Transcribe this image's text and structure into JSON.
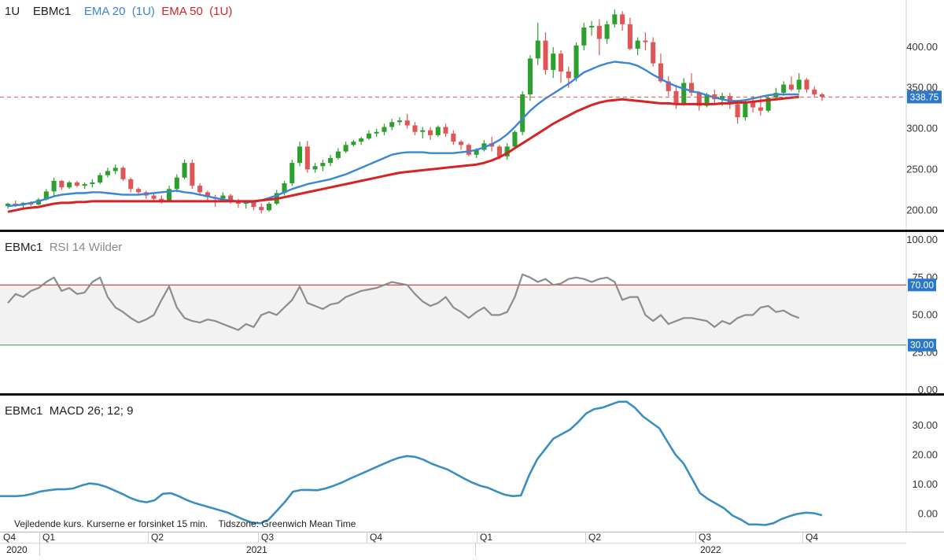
{
  "header": {
    "interval": "1U",
    "symbol": "EBMc1",
    "ema20_label": "EMA 20",
    "ema20_period": "(1U)",
    "ema50_label": "EMA 50",
    "ema50_period": "(1U)"
  },
  "rsi_panel": {
    "symbol": "EBMc1",
    "title": "RSI 14 Wilder"
  },
  "macd_panel": {
    "symbol": "EBMc1",
    "title": "MACD 26; 12; 9"
  },
  "footer_note": "Vejledende kurs. Kurserne er forsinket 15 min.",
  "timezone_note": "Tidszone: Greenwich Mean Time",
  "colors": {
    "up": "#2ca02c",
    "down": "#e05555",
    "ema20": "#3a86d4",
    "ema50": "#d62424",
    "rsi": "#8c8c8c",
    "macd": "#3a8fc1",
    "upper_band": "#cc3333",
    "lower_band": "#44aa44"
  },
  "chart_data": [
    {
      "type": "candlestick",
      "title": "EBMc1",
      "interval": "1U",
      "ylim": [
        180,
        450
      ],
      "y_ticks": [
        200,
        250,
        300,
        350,
        400
      ],
      "y_tick_labels": [
        "200.00",
        "250.00",
        "300.00",
        "350.00",
        "400.00"
      ],
      "last_price": 338.75,
      "last_price_label": "338.75",
      "candles": [
        [
          205,
          209,
          202,
          208
        ],
        [
          208,
          212,
          204,
          206
        ],
        [
          206,
          210,
          203,
          209
        ],
        [
          209,
          211,
          205,
          207
        ],
        [
          207,
          215,
          206,
          213
        ],
        [
          213,
          226,
          212,
          223
        ],
        [
          223,
          240,
          218,
          236
        ],
        [
          236,
          237,
          225,
          228
        ],
        [
          228,
          236,
          226,
          234
        ],
        [
          234,
          236,
          228,
          230
        ],
        [
          230,
          234,
          226,
          232
        ],
        [
          232,
          238,
          228,
          234
        ],
        [
          234,
          246,
          232,
          243
        ],
        [
          243,
          252,
          240,
          248
        ],
        [
          248,
          256,
          244,
          252
        ],
        [
          252,
          254,
          236,
          238
        ],
        [
          238,
          240,
          222,
          226
        ],
        [
          226,
          228,
          218,
          222
        ],
        [
          222,
          224,
          214,
          218
        ],
        [
          218,
          220,
          210,
          214
        ],
        [
          214,
          218,
          208,
          212
        ],
        [
          212,
          230,
          210,
          226
        ],
        [
          226,
          244,
          222,
          240
        ],
        [
          240,
          262,
          238,
          258
        ],
        [
          258,
          262,
          226,
          230
        ],
        [
          230,
          233,
          218,
          222
        ],
        [
          222,
          224,
          212,
          216
        ],
        [
          216,
          219,
          204,
          214
        ],
        [
          214,
          222,
          210,
          218
        ],
        [
          218,
          220,
          208,
          212
        ],
        [
          212,
          214,
          203,
          208
        ],
        [
          208,
          212,
          202,
          210
        ],
        [
          210,
          212,
          200,
          204
        ],
        [
          204,
          208,
          196,
          200
        ],
        [
          200,
          210,
          198,
          208
        ],
        [
          208,
          225,
          206,
          221
        ],
        [
          221,
          236,
          218,
          233
        ],
        [
          233,
          262,
          230,
          258
        ],
        [
          258,
          284,
          254,
          278
        ],
        [
          278,
          285,
          246,
          250
        ],
        [
          250,
          258,
          246,
          254
        ],
        [
          254,
          262,
          248,
          258
        ],
        [
          258,
          268,
          254,
          264
        ],
        [
          264,
          276,
          262,
          272
        ],
        [
          272,
          284,
          270,
          280
        ],
        [
          280,
          286,
          278,
          284
        ],
        [
          284,
          290,
          280,
          288
        ],
        [
          288,
          298,
          286,
          294
        ],
        [
          294,
          300,
          290,
          296
        ],
        [
          296,
          306,
          292,
          302
        ],
        [
          302,
          312,
          298,
          308
        ],
        [
          308,
          314,
          304,
          310
        ],
        [
          310,
          318,
          300,
          304
        ],
        [
          304,
          308,
          292,
          296
        ],
        [
          296,
          302,
          288,
          298
        ],
        [
          298,
          302,
          286,
          292
        ],
        [
          292,
          304,
          290,
          302
        ],
        [
          302,
          306,
          290,
          294
        ],
        [
          294,
          298,
          280,
          284
        ],
        [
          284,
          286,
          274,
          280
        ],
        [
          280,
          282,
          266,
          268
        ],
        [
          268,
          276,
          264,
          274
        ],
        [
          274,
          286,
          272,
          282
        ],
        [
          282,
          290,
          272,
          278
        ],
        [
          278,
          280,
          262,
          266
        ],
        [
          266,
          282,
          262,
          278
        ],
        [
          278,
          298,
          275,
          296
        ],
        [
          296,
          346,
          292,
          342
        ],
        [
          342,
          390,
          334,
          386
        ],
        [
          386,
          430,
          378,
          408
        ],
        [
          408,
          418,
          366,
          372
        ],
        [
          372,
          400,
          362,
          392
        ],
        [
          392,
          396,
          356,
          370
        ],
        [
          370,
          376,
          350,
          362
        ],
        [
          362,
          406,
          358,
          402
        ],
        [
          402,
          430,
          396,
          424
        ],
        [
          424,
          432,
          414,
          426
        ],
        [
          426,
          434,
          390,
          410
        ],
        [
          410,
          432,
          404,
          428
        ],
        [
          428,
          446,
          424,
          440
        ],
        [
          440,
          444,
          420,
          428
        ],
        [
          428,
          436,
          396,
          398
        ],
        [
          398,
          412,
          390,
          408
        ],
        [
          408,
          418,
          396,
          406
        ],
        [
          406,
          412,
          376,
          380
        ],
        [
          380,
          392,
          356,
          358
        ],
        [
          358,
          364,
          340,
          346
        ],
        [
          346,
          354,
          324,
          330
        ],
        [
          330,
          362,
          328,
          356
        ],
        [
          356,
          368,
          340,
          344
        ],
        [
          344,
          346,
          322,
          328
        ],
        [
          328,
          344,
          326,
          342
        ],
        [
          342,
          348,
          330,
          336
        ],
        [
          336,
          344,
          328,
          340
        ],
        [
          340,
          344,
          324,
          330
        ],
        [
          330,
          332,
          306,
          314
        ],
        [
          314,
          336,
          310,
          332
        ],
        [
          332,
          340,
          320,
          326
        ],
        [
          326,
          338,
          316,
          322
        ],
        [
          322,
          342,
          320,
          338
        ],
        [
          338,
          350,
          334,
          344
        ],
        [
          344,
          358,
          340,
          354
        ],
        [
          354,
          364,
          346,
          348
        ],
        [
          348,
          368,
          344,
          360
        ],
        [
          360,
          362,
          344,
          348
        ],
        [
          348,
          352,
          338,
          342
        ],
        [
          342,
          344,
          334,
          339
        ]
      ],
      "series": [
        {
          "name": "EMA 20",
          "values": [
            205,
            206,
            207,
            209,
            211,
            214,
            217,
            219,
            220,
            221,
            221,
            222,
            222,
            221,
            220,
            219,
            219,
            219,
            220,
            221,
            222,
            223,
            224,
            222,
            221,
            219,
            217,
            215,
            213,
            212,
            211,
            210,
            210,
            212,
            215,
            218,
            222,
            226,
            229,
            232,
            234,
            236,
            238,
            241,
            244,
            248,
            252,
            256,
            260,
            264,
            268,
            270,
            271,
            271,
            271,
            270,
            270,
            270,
            270,
            271,
            272,
            274,
            277,
            281,
            286,
            293,
            302,
            312,
            322,
            330,
            337,
            343,
            349,
            355,
            362,
            369,
            373,
            377,
            380,
            382,
            381,
            380,
            377,
            372,
            366,
            361,
            356,
            352,
            349,
            346,
            344,
            341,
            338,
            336,
            334,
            334,
            335,
            337,
            339,
            341,
            342,
            342,
            342,
            342
          ]
        },
        {
          "name": "EMA 50",
          "values": [
            198,
            200,
            202,
            203,
            204,
            206,
            208,
            209,
            209,
            210,
            210,
            211,
            211,
            211,
            211,
            211,
            211,
            211,
            211,
            211,
            211,
            211,
            211,
            211,
            211,
            211,
            211,
            211,
            211,
            211,
            211,
            211,
            211,
            212,
            213,
            214,
            216,
            218,
            220,
            222,
            224,
            226,
            228,
            230,
            232,
            234,
            236,
            238,
            240,
            242,
            244,
            246,
            247,
            248,
            249,
            250,
            251,
            252,
            253,
            254,
            255,
            256,
            258,
            261,
            265,
            270,
            276,
            282,
            288,
            294,
            300,
            306,
            311,
            316,
            321,
            325,
            329,
            332,
            334,
            335,
            336,
            335,
            334,
            333,
            332,
            331,
            331,
            330,
            330,
            330,
            330,
            330,
            330,
            331,
            331,
            332,
            332,
            333,
            334,
            335,
            336,
            337,
            338,
            339
          ]
        }
      ]
    },
    {
      "type": "line",
      "title": "RSI 14 Wilder",
      "ylim": [
        0,
        100
      ],
      "y_ticks": [
        0,
        25,
        50,
        75,
        100
      ],
      "y_tick_labels": [
        "0.00",
        "25.00",
        "50.00",
        "75.00",
        "100.00"
      ],
      "bands": [
        {
          "name": "upper",
          "value": 70,
          "label": "70.00"
        },
        {
          "name": "lower",
          "value": 30,
          "label": "30.00"
        }
      ],
      "series": [
        {
          "name": "RSI 14 Wilder",
          "values": [
            58,
            64,
            62,
            66,
            68,
            72,
            75,
            66,
            68,
            64,
            65,
            72,
            75,
            62,
            55,
            52,
            48,
            45,
            47,
            50,
            60,
            69,
            55,
            48,
            46,
            45,
            47,
            46,
            44,
            42,
            40,
            44,
            42,
            50,
            52,
            50,
            55,
            60,
            69,
            58,
            56,
            54,
            57,
            58,
            62,
            64,
            66,
            67,
            68,
            70,
            72,
            71,
            70,
            64,
            59,
            56,
            58,
            62,
            55,
            52,
            48,
            52,
            55,
            50,
            50,
            52,
            62,
            77,
            75,
            72,
            74,
            70,
            71,
            74,
            75,
            74,
            72,
            74,
            75,
            72,
            60,
            62,
            62,
            50,
            46,
            50,
            44,
            46,
            48,
            48,
            47,
            46,
            42,
            46,
            44,
            48,
            50,
            50,
            55,
            56,
            52,
            53,
            50,
            48
          ]
        }
      ]
    },
    {
      "type": "line",
      "title": "MACD 26; 12; 9",
      "ylim": [
        -5,
        39
      ],
      "y_ticks": [
        0,
        10,
        20,
        30
      ],
      "y_tick_labels": [
        "0.00",
        "10.00",
        "20.00",
        "30.00"
      ],
      "x_quarter_labels": [
        "Q4",
        "Q1",
        "Q2",
        "Q3",
        "Q4",
        "Q1",
        "Q2",
        "Q3",
        "Q4"
      ],
      "x_year_labels": [
        "2020",
        "2021",
        "2022"
      ],
      "series": [
        {
          "name": "MACD",
          "values": [
            6,
            6,
            6,
            6.2,
            6.8,
            7.6,
            8,
            8.3,
            8.3,
            8.6,
            9.6,
            10.3,
            10,
            9.2,
            8,
            6.8,
            5.4,
            4.4,
            3.9,
            4.6,
            6.8,
            7,
            5.9,
            4.6,
            3.6,
            2.8,
            2,
            1.2,
            0.4,
            -0.8,
            -2,
            -3,
            -3.2,
            -2,
            1,
            4,
            7.5,
            8.1,
            8.1,
            8,
            8.6,
            9.5,
            10.6,
            11.9,
            13.1,
            14.3,
            15.6,
            16.8,
            18,
            19,
            19.6,
            19.3,
            18.4,
            17,
            16,
            15,
            13.5,
            12,
            10.6,
            9.5,
            8.8,
            7.6,
            6.5,
            6,
            6.2,
            13,
            18.5,
            22,
            25.5,
            27,
            28.5,
            31,
            34,
            35.5,
            36,
            37,
            38,
            38,
            36,
            33,
            31,
            29,
            24.5,
            20,
            17,
            12,
            7,
            5,
            3.4,
            1.8,
            -0.6,
            -1.9,
            -3.6,
            -3.6,
            -3.8,
            -3.2,
            -1.8,
            -0.8,
            0,
            0.4,
            0.2,
            -0.5
          ]
        }
      ]
    }
  ]
}
